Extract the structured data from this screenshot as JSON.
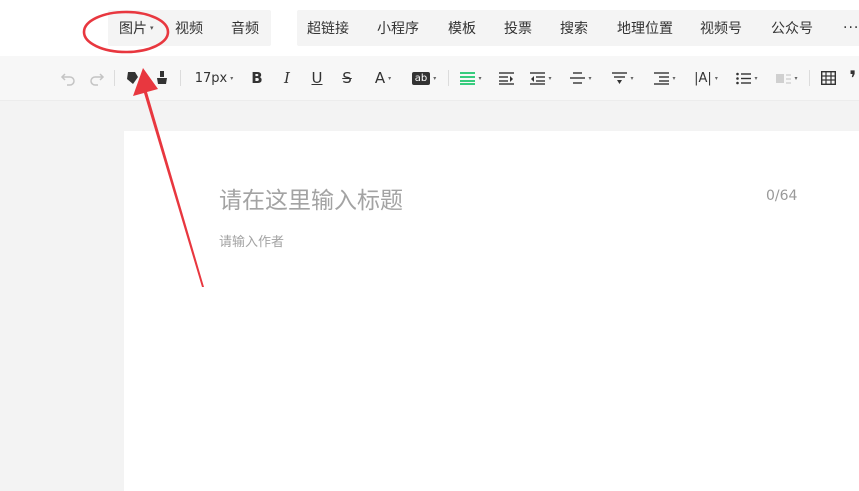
{
  "insert_toolbar": {
    "media": [
      {
        "label": "图片",
        "caret": "▾"
      },
      {
        "label": "视频"
      },
      {
        "label": "音频"
      }
    ],
    "more": [
      {
        "label": "超链接"
      },
      {
        "label": "小程序"
      },
      {
        "label": "模板"
      },
      {
        "label": "投票"
      },
      {
        "label": "搜索"
      },
      {
        "label": "地理位置"
      },
      {
        "label": "视频号"
      },
      {
        "label": "公众号"
      },
      {
        "label": "···"
      }
    ]
  },
  "format_toolbar": {
    "font_size": "17px",
    "bold": "B",
    "italic": "I",
    "underline": "U",
    "strike": "S",
    "font_color": "A",
    "bg_color": "ab",
    "letter_spacing": "|A|",
    "icons": [
      "undo-icon",
      "redo-icon",
      "format-painter-icon",
      "clear-format-icon",
      "align-justify-icon",
      "indent-icon",
      "outdent-icon",
      "line-height-icon",
      "paragraph-spacing-icon",
      "text-indent-icon",
      "list-icon",
      "image-layout-icon",
      "table-icon",
      "quote-icon"
    ],
    "accent_color": "#07c160"
  },
  "editor": {
    "title_placeholder": "请在这里输入标题",
    "title_counter": "0/64",
    "author_placeholder": "请输入作者"
  },
  "annotation": {
    "color": "#e8373f",
    "shapes": [
      "ellipse-highlight",
      "arrow"
    ]
  }
}
